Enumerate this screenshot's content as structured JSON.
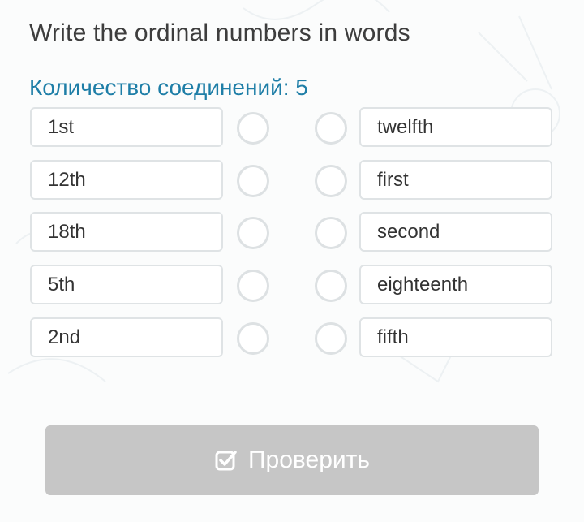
{
  "task": {
    "title": "Write the ordinal numbers in words",
    "connections_label": "Количество соединений: 5"
  },
  "left_items": [
    "1st",
    "12th",
    "18th",
    "5th",
    "2nd"
  ],
  "right_items": [
    "twelfth",
    "first",
    "second",
    "eighteenth",
    "fifth"
  ],
  "button": {
    "label": "Проверить",
    "icon": "checkbox-check-icon",
    "state": "disabled"
  },
  "colors": {
    "title": "#3d3d3d",
    "connections": "#1e7ea7",
    "button_bg": "#c6c6c6"
  }
}
